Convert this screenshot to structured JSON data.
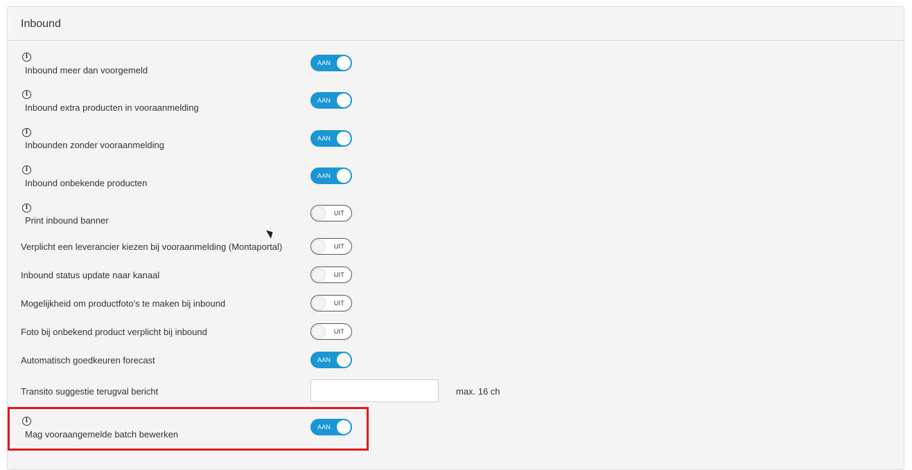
{
  "panel": {
    "title": "Inbound"
  },
  "rows": [
    {
      "label": "Inbound meer dan voorgemeld",
      "toggle": "AAN",
      "on": true,
      "info": true
    },
    {
      "label": "Inbound extra producten in vooraanmelding",
      "toggle": "AAN",
      "on": true,
      "info": true
    },
    {
      "label": "Inbounden zonder vooraanmelding",
      "toggle": "AAN",
      "on": true,
      "info": true
    },
    {
      "label": "Inbound onbekende producten",
      "toggle": "AAN",
      "on": true,
      "info": true
    },
    {
      "label": "Print inbound banner",
      "toggle": "UIT",
      "on": false,
      "info": true
    },
    {
      "label": "Verplicht een leverancier kiezen bij vooraanmelding (Montaportal)",
      "toggle": "UIT",
      "on": false,
      "info": false
    },
    {
      "label": "Inbound status update naar kanaal",
      "toggle": "UIT",
      "on": false,
      "info": false
    },
    {
      "label": "Mogelijkheid om productfoto's te maken bij inbound",
      "toggle": "UIT",
      "on": false,
      "info": false
    },
    {
      "label": "Foto bij onbekend product verplicht bij inbound",
      "toggle": "UIT",
      "on": false,
      "info": false
    },
    {
      "label": "Automatisch goedkeuren forecast",
      "toggle": "AAN",
      "on": true,
      "info": false
    }
  ],
  "text_row": {
    "label": "Transito suggestie terugval bericht",
    "value": "",
    "hint": "max. 16 ch"
  },
  "last_row": {
    "label": "Mag vooraangemelde batch bewerken",
    "toggle": "AAN",
    "on": true,
    "info": true
  },
  "icons": {
    "info": "info-icon",
    "cursor": "mouse-pointer-icon"
  },
  "colors": {
    "toggle_on": "#1a96d4",
    "highlight": "#e3141c",
    "panel_bg": "#f4f4f4"
  }
}
